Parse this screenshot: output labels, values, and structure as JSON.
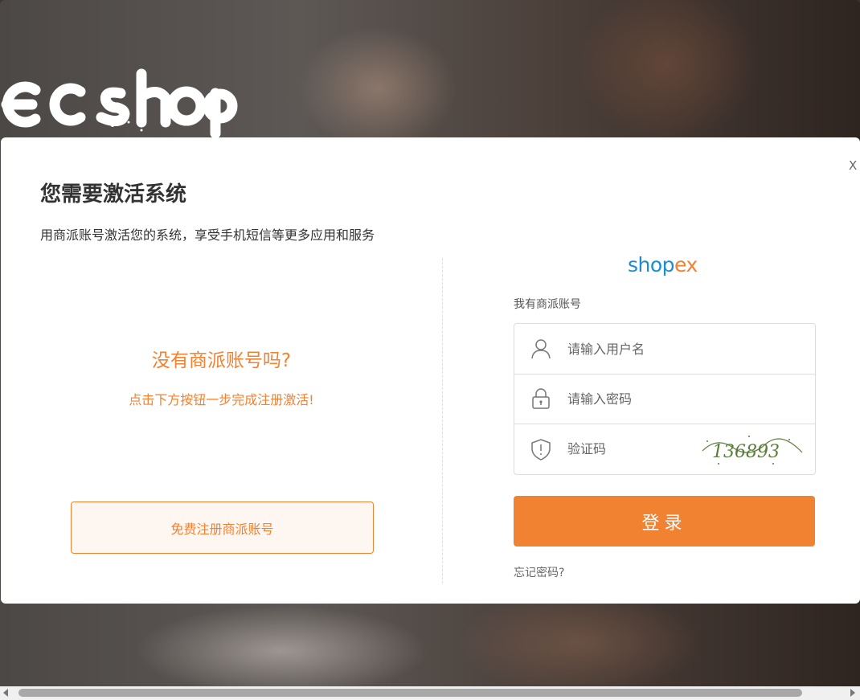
{
  "logo": {
    "text": "ECSHOP"
  },
  "modal": {
    "close_label": "X",
    "title": "您需要激活系统",
    "subtitle": "用商派账号激活您的系统，享受手机短信等更多应用和服务"
  },
  "left_panel": {
    "heading": "没有商派账号吗?",
    "subheading": "点击下方按钮一步完成注册激活!",
    "register_button": "免费注册商派账号"
  },
  "right_panel": {
    "brand_shop": "shop",
    "brand_ex": "ex",
    "account_label": "我有商派账号",
    "username_placeholder": "请输入用户名",
    "password_placeholder": "请输入密码",
    "captcha_placeholder": "验证码",
    "captcha_text": "136893",
    "login_button": "登录",
    "forgot_link": "忘记密码?"
  },
  "colors": {
    "accent": "#f08232",
    "brand_blue": "#1a8ecf",
    "captcha_green": "#5a7d3a"
  },
  "icons": [
    "user-icon",
    "lock-icon",
    "shield-icon",
    "close-icon"
  ]
}
